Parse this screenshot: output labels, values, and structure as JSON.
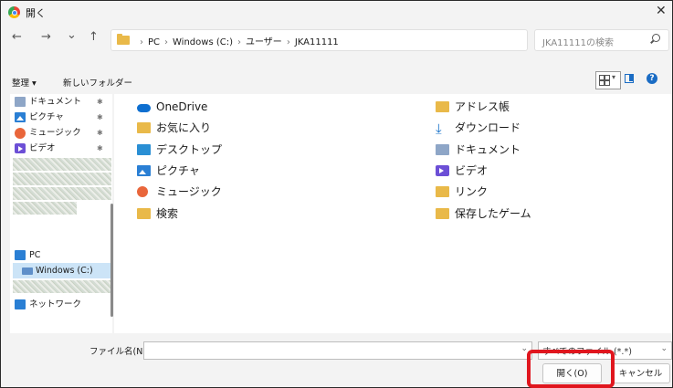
{
  "window": {
    "title": "開く",
    "close_glyph": "✕"
  },
  "navigation": {
    "back": "←",
    "forward": "→",
    "dropdown": "⌄",
    "up": "↑",
    "breadcrumbs": [
      "PC",
      "Windows (C:)",
      "ユーザー",
      "JKA11111"
    ],
    "separator": "›",
    "refresh_glyph": "↻",
    "search_placeholder": "JKA11111の検索"
  },
  "toolbar": {
    "organize": "整理 ▾",
    "new_folder": "新しいフォルダー"
  },
  "sidebar": {
    "quick_items": [
      {
        "label": "ドキュメント",
        "icon": "documents-icon",
        "pinned": true
      },
      {
        "label": "ピクチャ",
        "icon": "pictures-icon",
        "pinned": true
      },
      {
        "label": "ミュージック",
        "icon": "music-icon",
        "pinned": true
      },
      {
        "label": "ビデオ",
        "icon": "videos-icon",
        "pinned": true
      }
    ],
    "pin_glyph": "📌",
    "pc_label": "PC",
    "drive_label": "Windows (C:)",
    "network_label": "ネットワーク"
  },
  "main": {
    "left_column": [
      {
        "label": "OneDrive",
        "icon": "onedrive-icon"
      },
      {
        "label": "お気に入り",
        "icon": "folder-icon"
      },
      {
        "label": "デスクトップ",
        "icon": "desktop-icon"
      },
      {
        "label": "ピクチャ",
        "icon": "pictures-icon"
      },
      {
        "label": "ミュージック",
        "icon": "music-icon"
      },
      {
        "label": "検索",
        "icon": "folder-icon"
      }
    ],
    "right_column": [
      {
        "label": "アドレス帳",
        "icon": "folder-icon"
      },
      {
        "label": "ダウンロード",
        "icon": "download-icon"
      },
      {
        "label": "ドキュメント",
        "icon": "documents-icon"
      },
      {
        "label": "ビデオ",
        "icon": "videos-icon"
      },
      {
        "label": "リンク",
        "icon": "folder-icon"
      },
      {
        "label": "保存したゲーム",
        "icon": "folder-icon"
      }
    ]
  },
  "footer": {
    "filename_label": "ファイル名(N):",
    "filename_value": "",
    "dropdown_glyph": "⌄",
    "filetype_value": "すべてのファイル (*.*)",
    "open_button": "開く(O)",
    "cancel_button": "キャンセル"
  },
  "colors": {
    "highlight": "#e0161e",
    "selection": "#cce4f7",
    "accent": "#1a6cc4"
  }
}
